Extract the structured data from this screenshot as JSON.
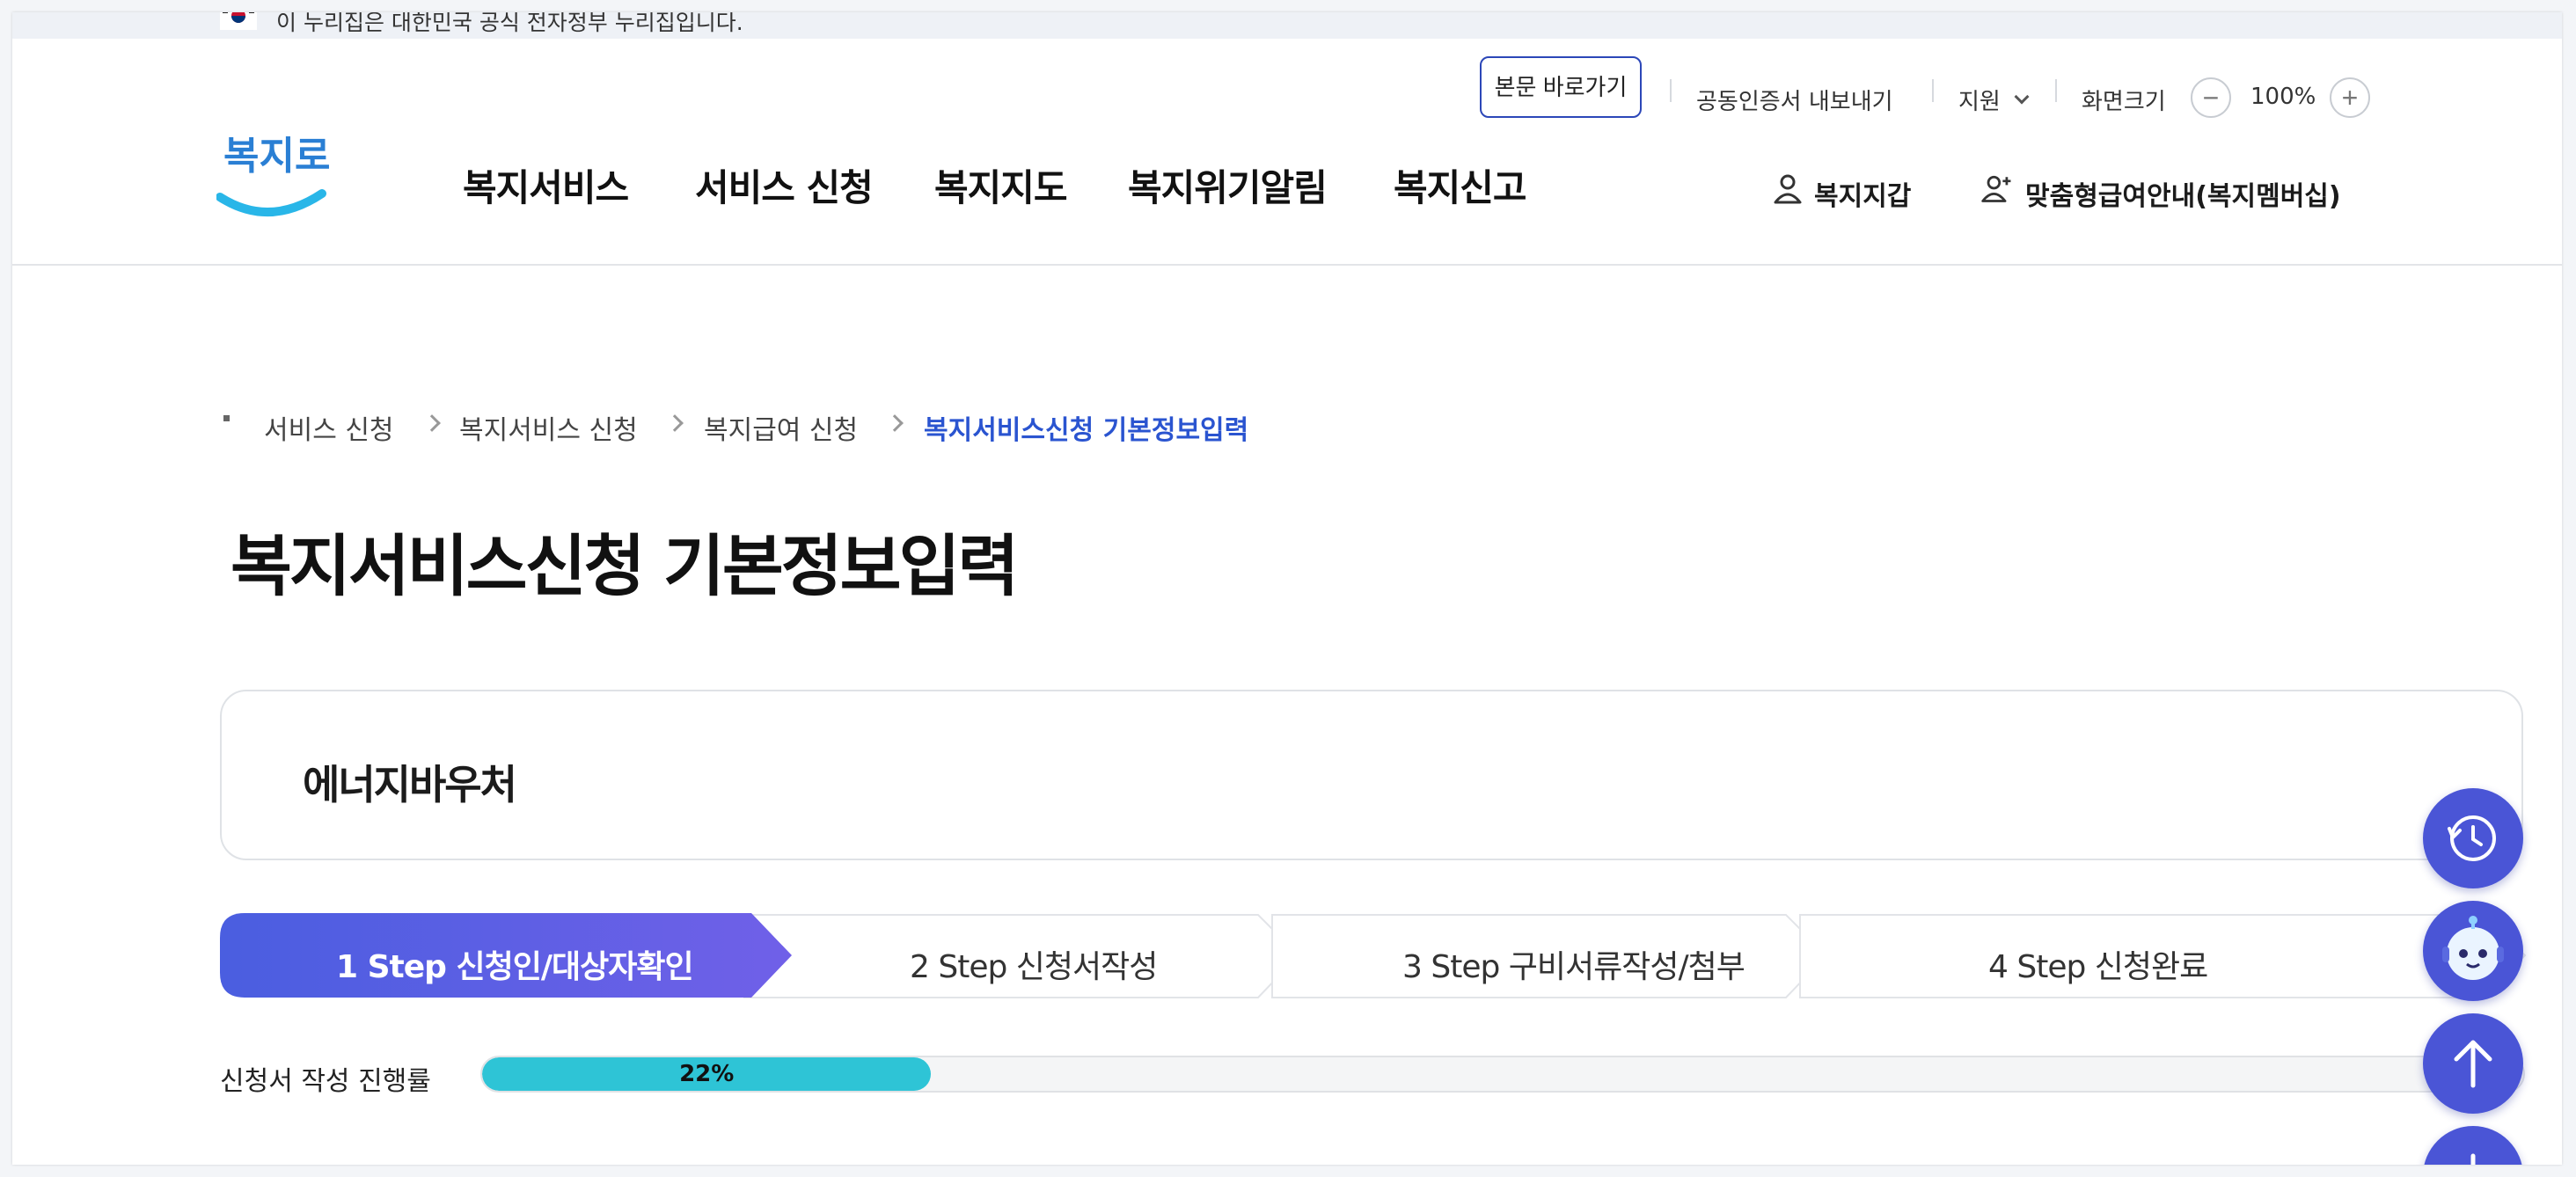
{
  "gov_banner": {
    "text": "이 누리집은 대한민국 공식 전자정부 누리집입니다."
  },
  "utility": {
    "skip_label": "본문 바로가기",
    "cert_export": "공동인증서 내보내기",
    "support": "지원",
    "screen_size_label": "화면크기",
    "zoom_level": "100%",
    "zoom_out": "−",
    "zoom_in": "+"
  },
  "logo": {
    "alt": "복지로"
  },
  "gnb": {
    "items": [
      "복지서비스",
      "서비스 신청",
      "복지지도",
      "복지위기알림",
      "복지신고"
    ]
  },
  "user_menu": {
    "wallet": "복지지갑",
    "membership": "맞춤형급여안내(복지멤버십)"
  },
  "breadcrumb": [
    "서비스 신청",
    "복지서비스 신청",
    "복지급여 신청",
    "복지서비스신청 기본정보입력"
  ],
  "page_title": "복지서비스신청 기본정보입력",
  "service_card": {
    "name": "에너지바우처"
  },
  "steps": [
    {
      "num": "1 Step",
      "label": "신청인/대상자확인",
      "active": true
    },
    {
      "num": "2 Step",
      "label": "신청서작성",
      "active": false
    },
    {
      "num": "3 Step",
      "label": "구비서류작성/첨부",
      "active": false
    },
    {
      "num": "4 Step",
      "label": "신청완료",
      "active": false
    }
  ],
  "progress": {
    "label": "신청서 작성 진행률",
    "value": 0.22,
    "text": "22%"
  },
  "floating": [
    "history-icon",
    "chatbot-icon",
    "arrow-up-icon",
    "plus-icon"
  ],
  "colors": {
    "accent": "#2a54d0",
    "step_active_start": "#4a5ee0",
    "step_active_end": "#7060e8",
    "progress": "#2ec4d6",
    "fab": "#4a55d6"
  }
}
